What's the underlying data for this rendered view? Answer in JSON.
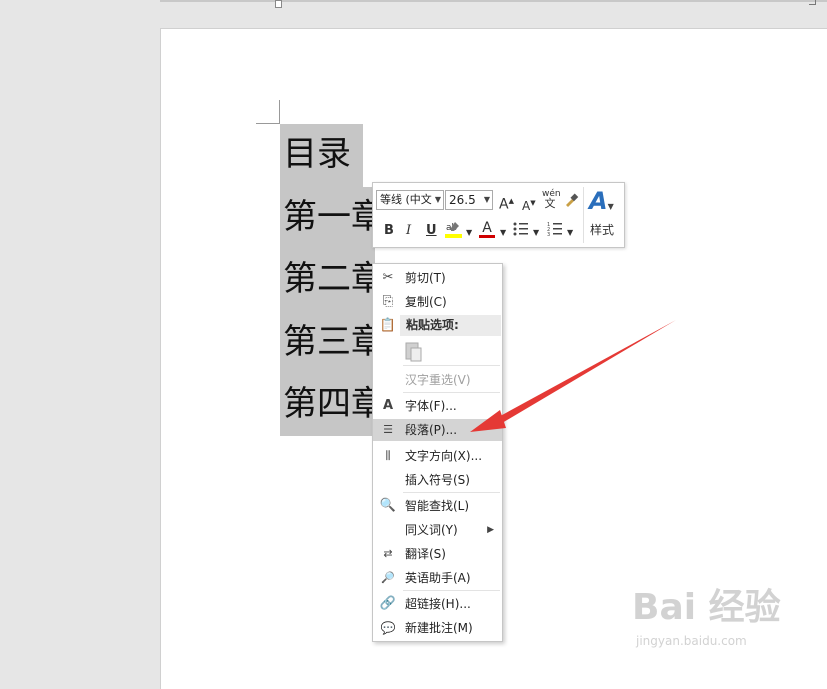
{
  "document": {
    "lines": [
      "目录",
      "第一章",
      "第二章",
      "第三章",
      "第四章"
    ]
  },
  "mini_toolbar": {
    "font_name": "等线 (中文",
    "font_size": "26.5",
    "grow_font": "A",
    "shrink_font": "A",
    "phonetic_top": "wén",
    "phonetic_bottom": "文",
    "bold": "B",
    "italic": "I",
    "underline": "U",
    "font_color_letter": "A",
    "styles_label": "样式",
    "highlight_color": "#ffff00",
    "font_color": "#d00000"
  },
  "context_menu": {
    "items": [
      {
        "label": "剪切(T)",
        "icon": "scissors-icon"
      },
      {
        "label": "复制(C)",
        "icon": "copy-icon"
      },
      {
        "label": "粘贴选项:",
        "icon": "paste-icon"
      },
      {
        "label": "汉字重选(V)",
        "icon": ""
      },
      {
        "label": "字体(F)...",
        "icon": "font-icon"
      },
      {
        "label": "段落(P)...",
        "icon": "paragraph-icon"
      },
      {
        "label": "文字方向(X)...",
        "icon": "text-direction-icon"
      },
      {
        "label": "插入符号(S)",
        "icon": ""
      },
      {
        "label": "智能查找(L)",
        "icon": "smart-lookup-icon"
      },
      {
        "label": "同义词(Y)",
        "icon": ""
      },
      {
        "label": "翻译(S)",
        "icon": "translate-icon"
      },
      {
        "label": "英语助手(A)",
        "icon": "english-assistant-icon"
      },
      {
        "label": "超链接(H)...",
        "icon": "hyperlink-icon"
      },
      {
        "label": "新建批注(M)",
        "icon": "new-comment-icon"
      }
    ],
    "highlighted_item": "段落(P)..."
  },
  "watermark": {
    "brand": "Bai 经验",
    "url": "jingyan.baidu.com"
  },
  "colors": {
    "selection": "#c6c6c6",
    "annotation_arrow": "#e53935"
  }
}
